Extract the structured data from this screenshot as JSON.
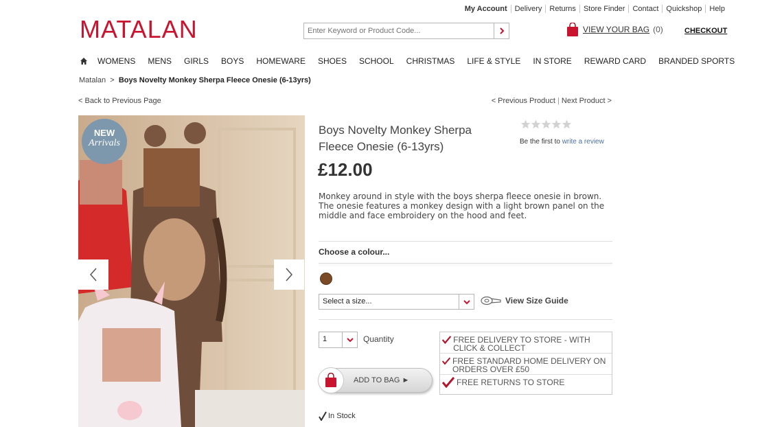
{
  "header": {
    "util_links": [
      "My Account",
      "Delivery",
      "Returns",
      "Store Finder",
      "Contact",
      "Quickshop",
      "Help"
    ],
    "logo": "MATALAN",
    "search_placeholder": "Enter Keyword or Product Code...",
    "bag_label": "VIEW YOUR BAG",
    "bag_count": "(0)",
    "checkout": "CHECKOUT"
  },
  "nav": [
    "WOMENS",
    "MENS",
    "GIRLS",
    "BOYS",
    "HOMEWARE",
    "SHOES",
    "SCHOOL",
    "CHRISTMAS",
    "LIFE & STYLE",
    "IN STORE",
    "REWARD CARD",
    "BRANDED SPORTS"
  ],
  "breadcrumb": {
    "root": "Matalan",
    "sep": ">",
    "current": "Boys Novelty Monkey Sherpa Fleece Onesie (6-13yrs)"
  },
  "pager": {
    "back": "< Back to Previous Page",
    "previous": "< Previous Product",
    "next": "Next Product >"
  },
  "badge": {
    "line1": "NEW",
    "line2": "Arrivals"
  },
  "product": {
    "title": "Boys Novelty Monkey Sherpa Fleece Onesie (6-13yrs)",
    "price": "£12.00",
    "description": "Monkey around in style with the boys sherpa fleece onesie in brown. The onesie features a monkey design with a light brown panel on the middle and face embroidery on the hood and feet.",
    "rating": 0,
    "review_prefix": "Be the first to",
    "review_link": "write a review",
    "choose_colour": "Choose a colour...",
    "colour_swatch": "#7a4a26",
    "size_placeholder": "Select a size...",
    "size_guide": "View Size Guide",
    "quantity": "1",
    "quantity_label": "Quantity",
    "add_to_bag": "ADD TO BAG ►",
    "stock": "In Stock"
  },
  "promos": [
    "FREE DELIVERY TO STORE - WITH CLICK & COLLECT",
    "FREE STANDARD HOME DELIVERY ON ORDERS OVER £50",
    "FREE RETURNS TO STORE"
  ],
  "colors": {
    "brand_red": "#c8142f",
    "link_blue": "#4a6fa3"
  }
}
